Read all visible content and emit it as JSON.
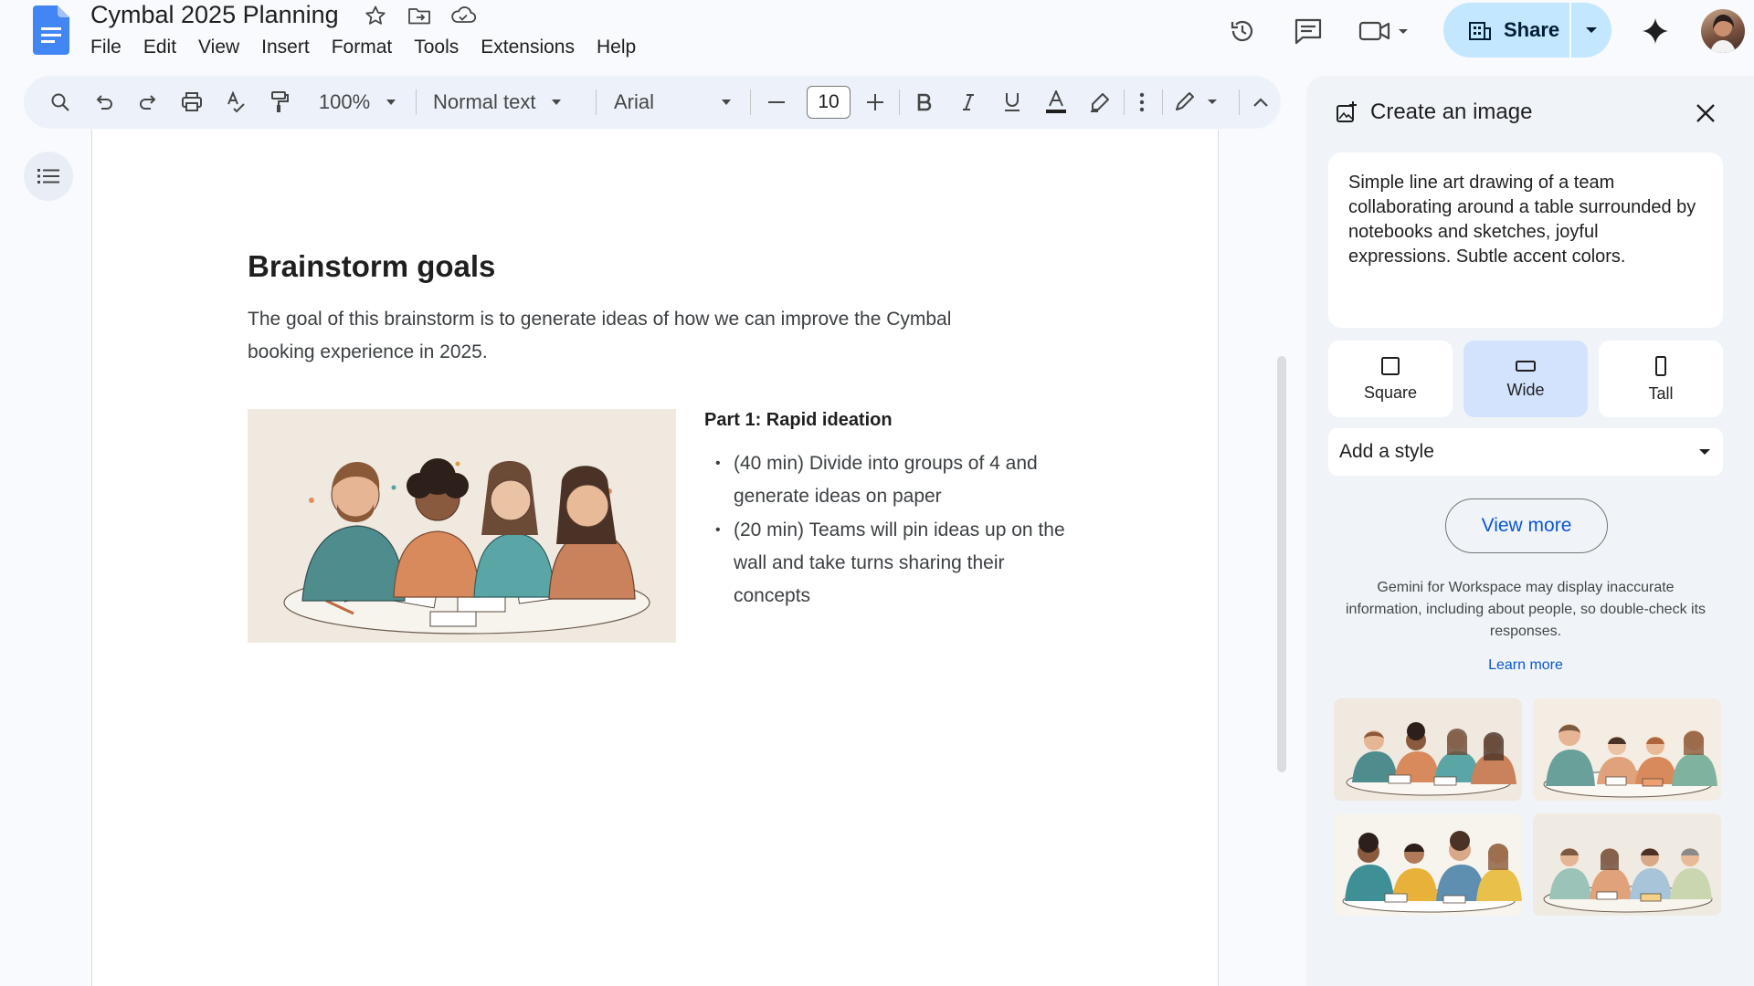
{
  "app": {
    "doc_title": "Cymbal 2025 Planning"
  },
  "menu": {
    "items": [
      "File",
      "Edit",
      "View",
      "Insert",
      "Format",
      "Tools",
      "Extensions",
      "Help"
    ]
  },
  "header": {
    "share_label": "Share"
  },
  "toolbar": {
    "zoom": "100%",
    "style": "Normal text",
    "font": "Arial",
    "font_size": "10"
  },
  "document": {
    "heading": "Brainstorm goals",
    "paragraph": "The goal of this brainstorm is to generate ideas of how we can improve the Cymbal booking experience in 2025.",
    "part_heading": "Part 1: Rapid ideation",
    "bullets": [
      "(40 min) Divide into groups of 4 and generate ideas on paper",
      "(20 min) Teams will pin ideas up on the wall and take turns sharing their concepts"
    ]
  },
  "panel": {
    "title": "Create an image",
    "prompt": "Simple line art drawing of a team collaborating around a table surrounded by notebooks and sketches, joyful expressions. Subtle accent colors.",
    "aspects": [
      {
        "label": "Square",
        "selected": false
      },
      {
        "label": "Wide",
        "selected": true
      },
      {
        "label": "Tall",
        "selected": false
      }
    ],
    "style_placeholder": "Add a style",
    "view_more": "View more",
    "disclaimer": "Gemini for Workspace may display inaccurate information, including about people, so double-check its responses.",
    "learn_more": "Learn more"
  },
  "colors": {
    "accent_blue": "#0b57d0",
    "share_bg": "#c2e7ff",
    "selected_aspect": "#d3e3fd",
    "panel_bg": "#f0f4f9",
    "toolbar_bg": "#edf2fa"
  }
}
